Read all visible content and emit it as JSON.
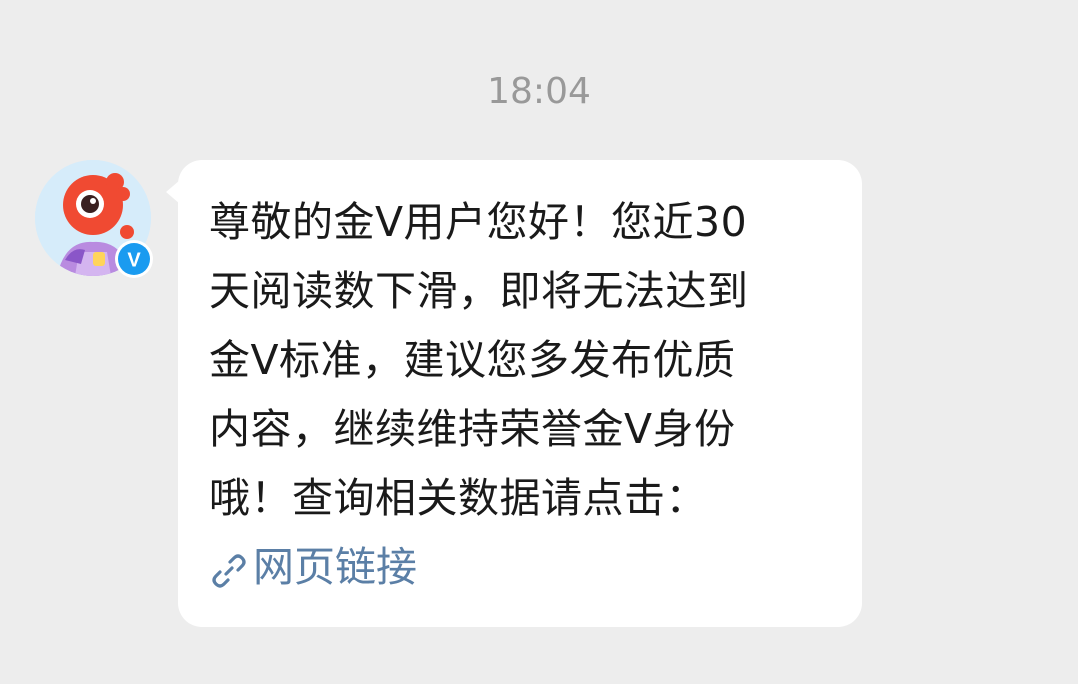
{
  "timestamp": "18:04",
  "sender": {
    "avatar_icon": "weibo-mascot-avatar-icon",
    "badge_icon": "verified-v-badge-icon",
    "badge_letter": "V",
    "badge_color": "#1a9bf0",
    "mascot_color": "#f04a32"
  },
  "message": {
    "lines": [
      "尊敬的金V用户您好！您近30",
      "天阅读数下滑，即将无法达到",
      "金V标准，建议您多发布优质",
      "内容，继续维持荣誉金V身份",
      "哦！查询相关数据请点击："
    ],
    "link_icon": "link-chain-icon",
    "link_label": "网页链接",
    "link_color": "#5b7fa6"
  }
}
